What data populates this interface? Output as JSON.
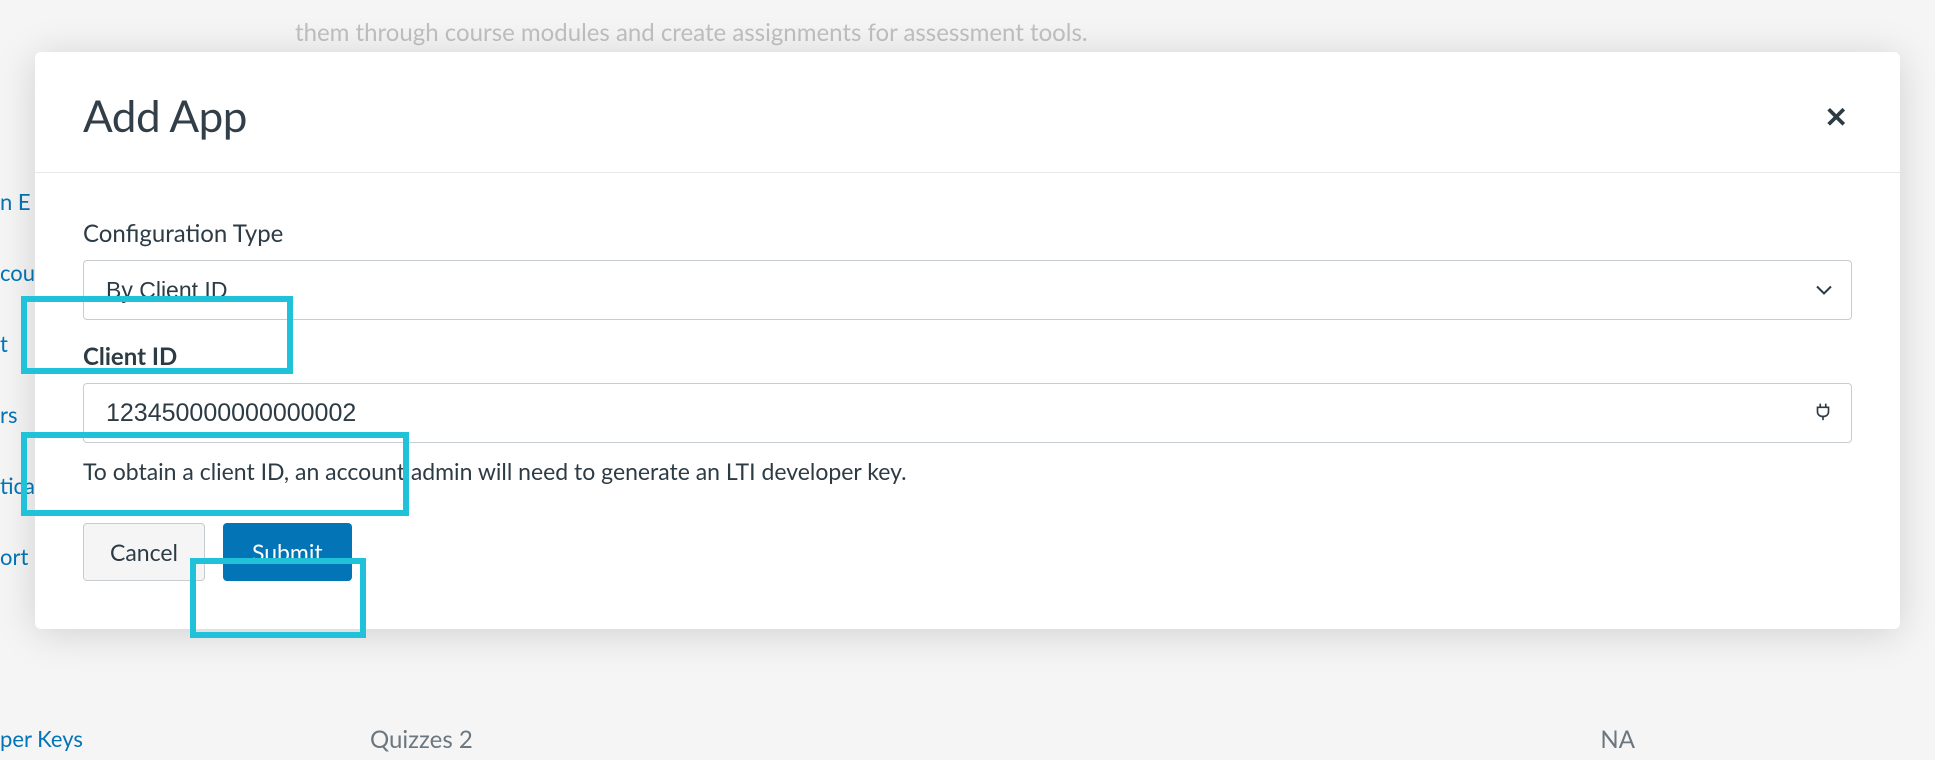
{
  "background": {
    "top_text": "them through course modules and create assignments for assessment tools.",
    "sidebar_items": [
      "n E",
      "cou",
      "t",
      "rs",
      "tica",
      "ort"
    ],
    "bottom_link": "per Keys",
    "bottom_left": "Quizzes 2",
    "bottom_right": "NA"
  },
  "modal": {
    "title": "Add App",
    "config_type_label": "Configuration Type",
    "config_type_value": "By Client ID",
    "client_id_label": "Client ID",
    "client_id_value": "123450000000000002",
    "help_text": "To obtain a client ID, an account admin will need to generate an LTI developer key.",
    "cancel_label": "Cancel",
    "submit_label": "Submit"
  }
}
